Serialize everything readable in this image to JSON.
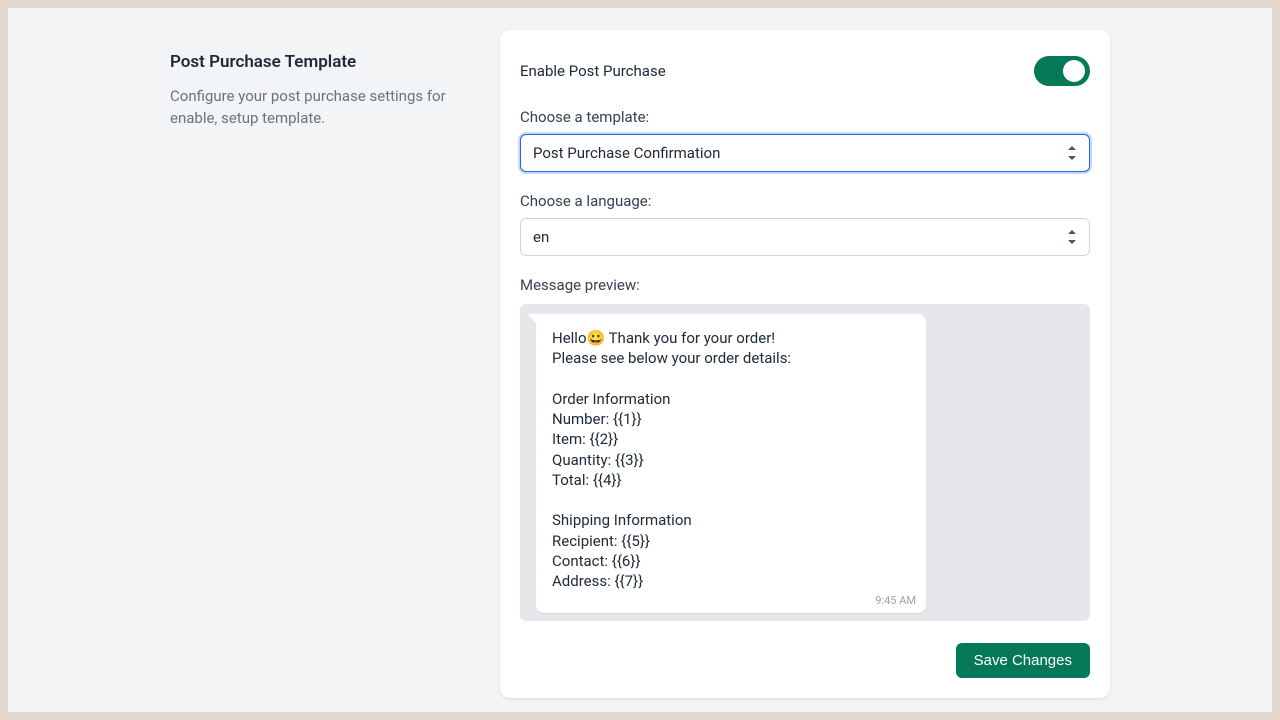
{
  "left": {
    "title": "Post Purchase Template",
    "description": "Configure your post purchase settings for enable, setup template."
  },
  "form": {
    "enable_label": "Enable Post Purchase",
    "enable_value": true,
    "template_label": "Choose a template:",
    "template_value": "Post Purchase Confirmation",
    "language_label": "Choose a language:",
    "language_value": "en",
    "preview_label": "Message preview:",
    "preview_body": "Hello😀 Thank you for your order!\nPlease see below your order details:\n\nOrder Information\nNumber: {{1}}\nItem: {{2}}\nQuantity: {{3}}\nTotal: {{4}}\n\nShipping Information\nRecipient: {{5}}\nContact: {{6}}\nAddress: {{7}}",
    "preview_time": "9:45 AM",
    "save_label": "Save Changes"
  }
}
